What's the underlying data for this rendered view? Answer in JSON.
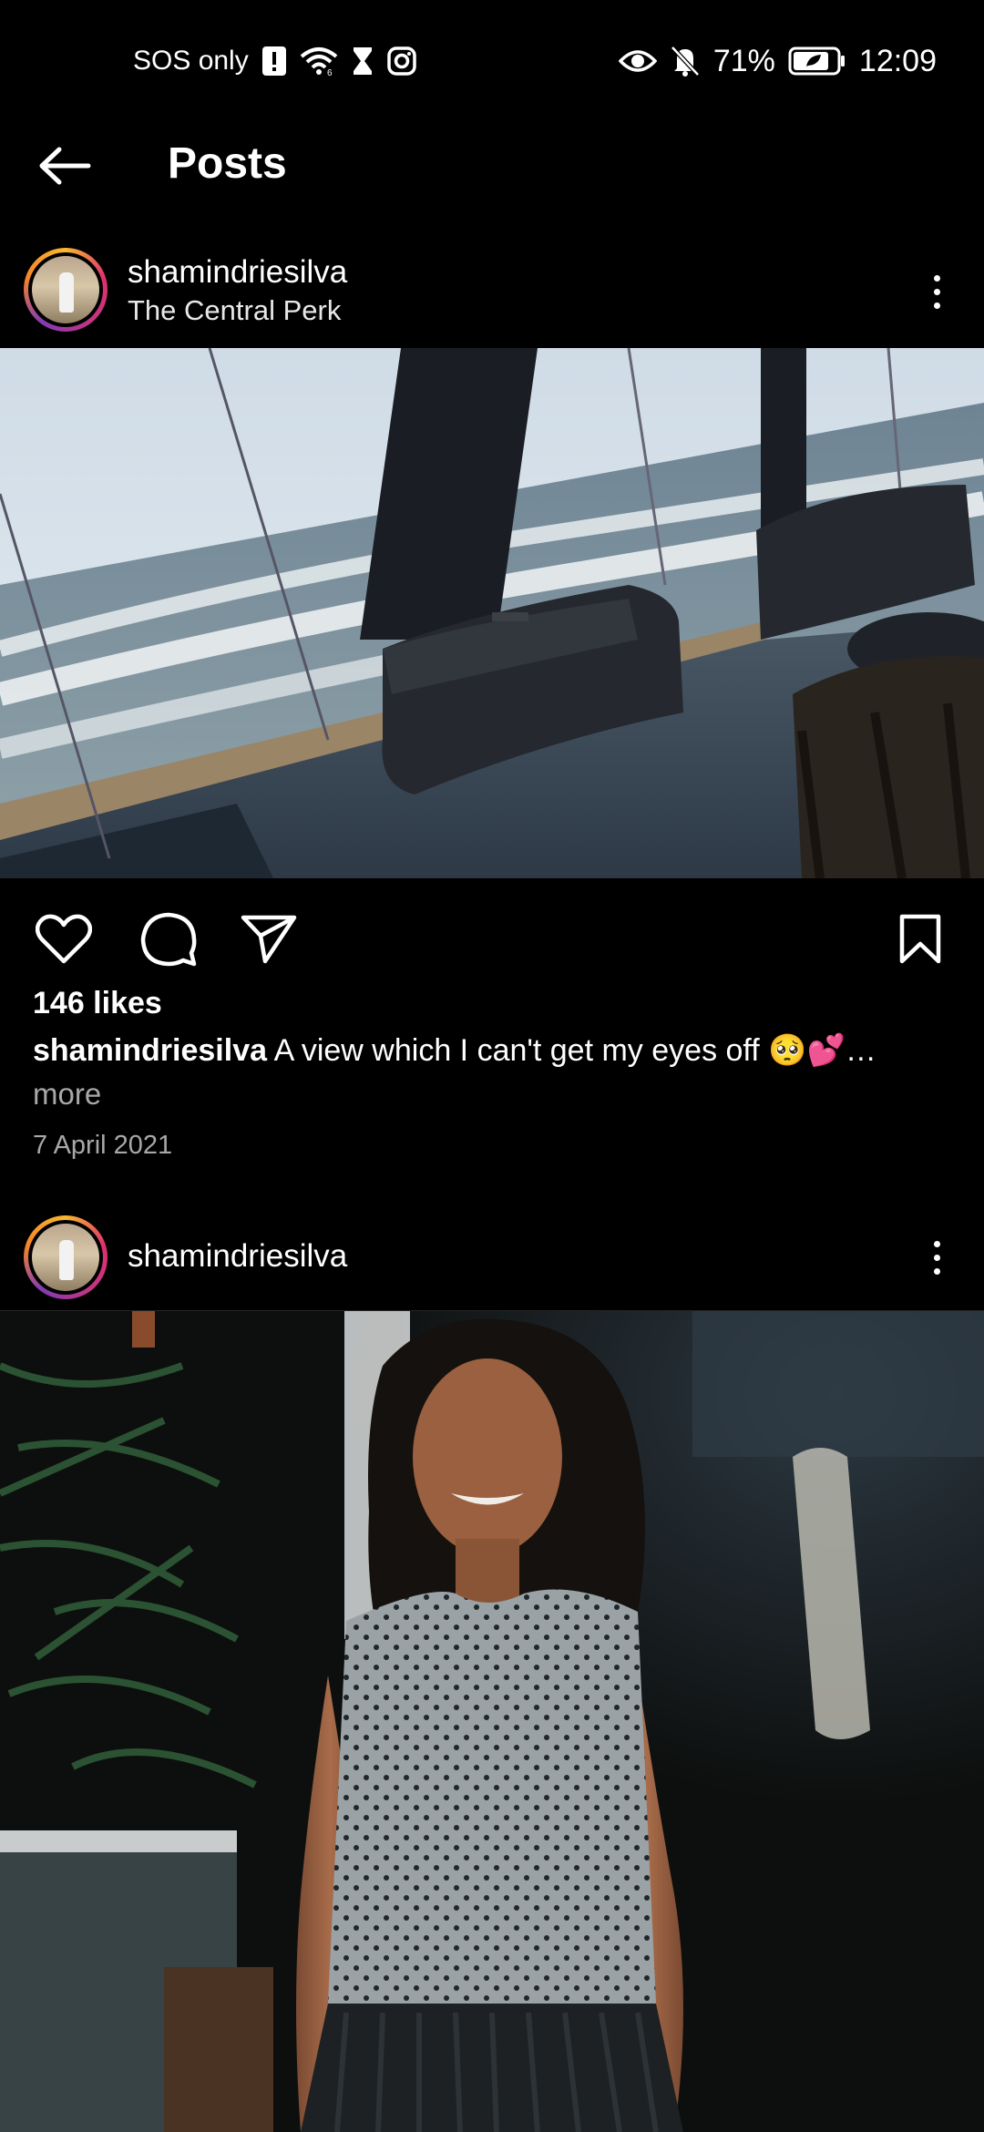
{
  "status_bar": {
    "carrier": "SOS only",
    "battery": "71%",
    "time": "12:09"
  },
  "header": {
    "title": "Posts"
  },
  "posts": [
    {
      "username": "shamindriesilva",
      "location": "The Central Perk",
      "likes": "146 likes",
      "caption_user": "shamindriesilva",
      "caption_text": "A view which I can't get my eyes off 🥺💕…",
      "caption_more": "more",
      "date": "7 April 2021"
    },
    {
      "username": "shamindriesilva"
    }
  ],
  "icons": {
    "status": [
      "alert-icon",
      "wifi-icon",
      "hourglass-icon",
      "instagram-icon",
      "eye-icon",
      "bell-off-icon",
      "battery-icon"
    ],
    "actions": [
      "heart-icon",
      "comment-icon",
      "share-icon",
      "bookmark-icon"
    ]
  },
  "colors": {
    "background": "#000000",
    "text": "#ffffff",
    "secondary_text": "#a8a8a8",
    "story_ring": [
      "#f7b731",
      "#e1306c",
      "#c13584",
      "#833ab4"
    ]
  }
}
